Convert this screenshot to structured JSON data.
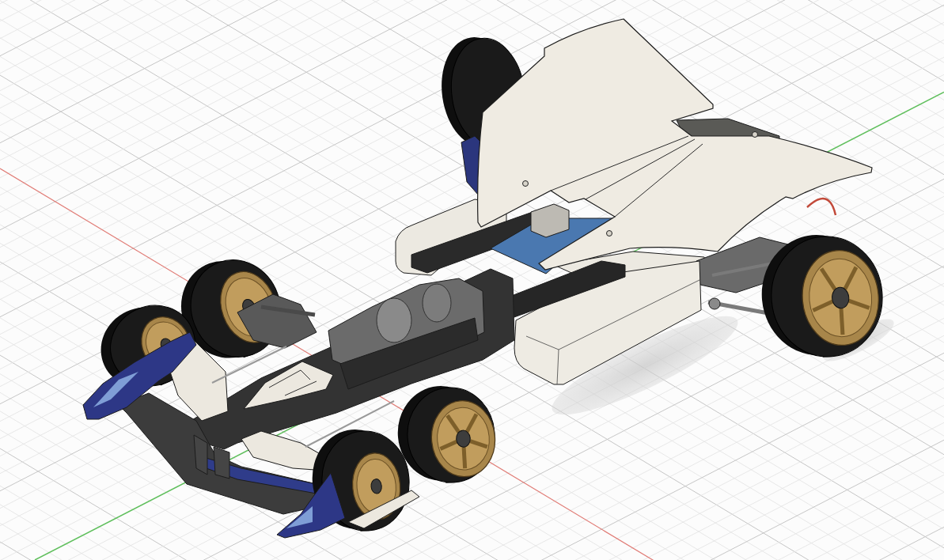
{
  "viewport": {
    "kind": "grid",
    "model": {
      "kind": "race-car"
    }
  }
}
